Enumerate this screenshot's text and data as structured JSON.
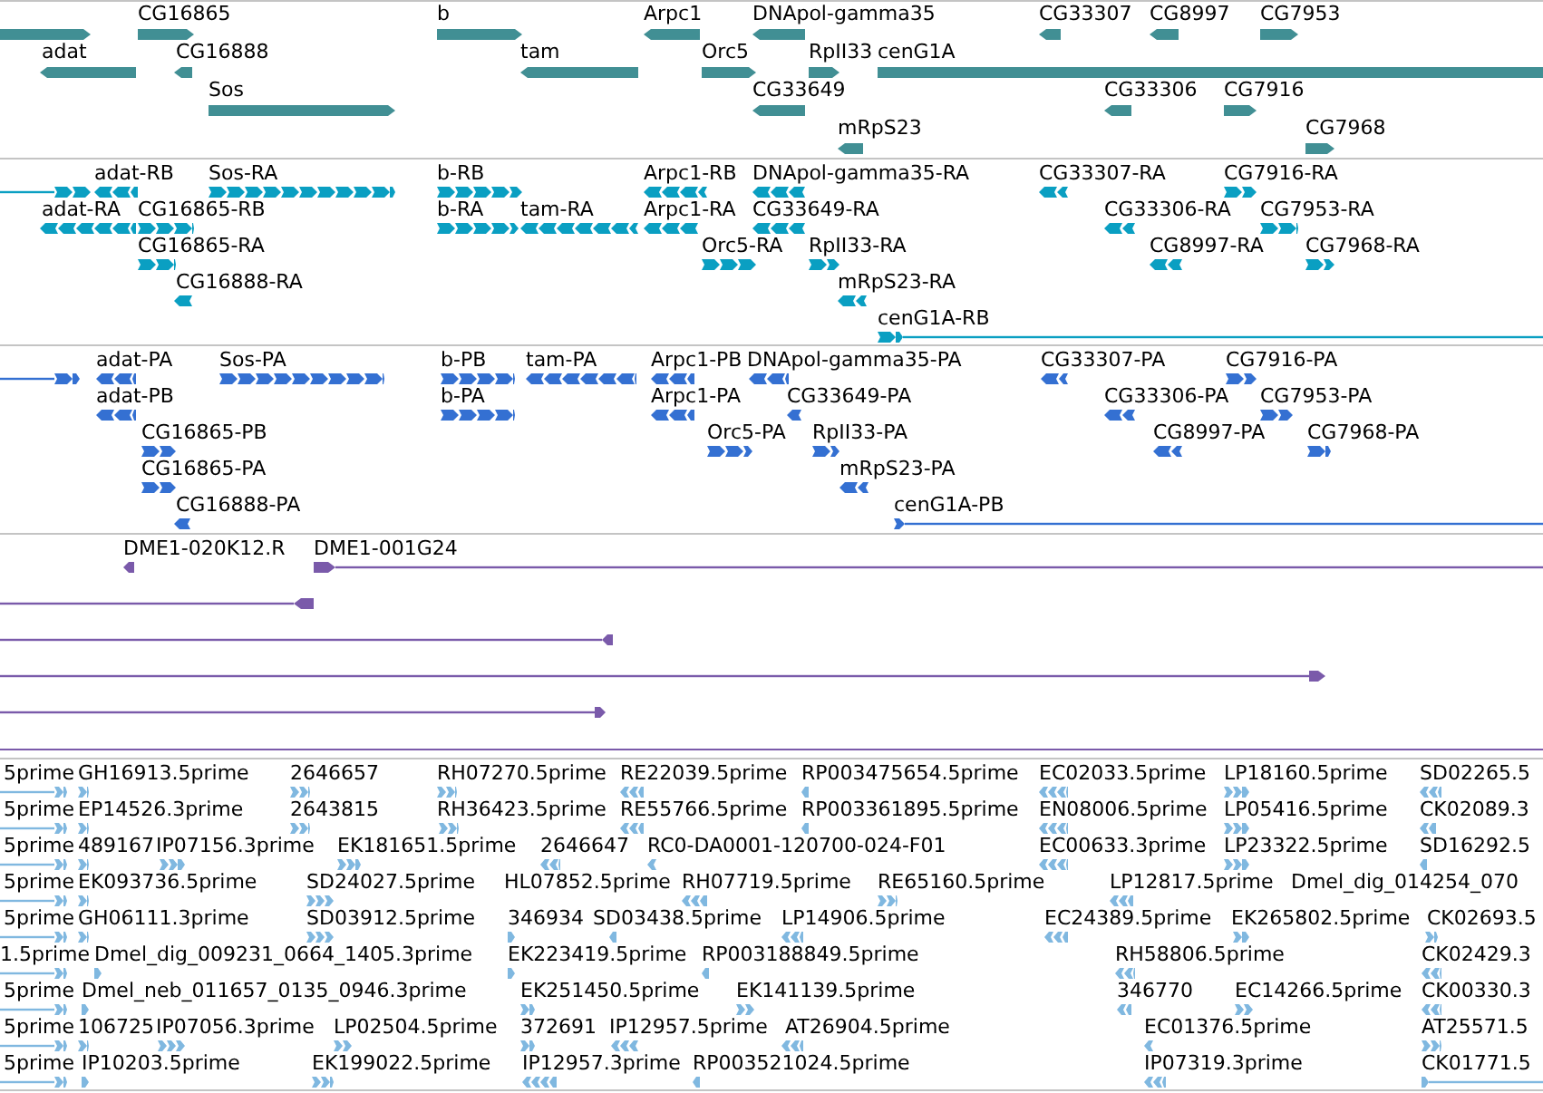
{
  "tracks": [
    {
      "kind": "gene",
      "color": "#418f94",
      "rows": [
        {
          "features": [
            {
              "reverse": false
            },
            {
              "label": "CG16865",
              "reverse": false
            },
            {
              "label": "b",
              "reverse": false
            },
            {
              "label": "Arpc1",
              "reverse": true
            },
            {
              "label": "DNApol-gamma35",
              "reverse": true
            },
            {
              "label": "CG33307",
              "reverse": true
            },
            {
              "label": "CG8997",
              "reverse": true
            },
            {
              "label": "CG7953",
              "reverse": false
            }
          ]
        },
        {
          "features": [
            {
              "label": "adat",
              "reverse": true
            },
            {
              "label": "CG16888",
              "reverse": true
            },
            {
              "label": "tam",
              "reverse": true
            },
            {
              "label": "Orc5",
              "reverse": false
            },
            {
              "label": "RpII33",
              "reverse": false
            },
            {
              "label": "cenG1A",
              "reverse": false
            }
          ]
        },
        {
          "features": [
            {
              "label": "Sos",
              "reverse": false
            },
            {
              "label": "CG33649",
              "reverse": true
            },
            {
              "label": "CG33306",
              "reverse": true
            },
            {
              "label": "CG7916",
              "reverse": false
            }
          ]
        },
        {
          "features": [
            {
              "label": "mRpS23",
              "reverse": true
            },
            {
              "label": "CG7968",
              "reverse": false
            }
          ]
        }
      ]
    },
    {
      "kind": "transcript",
      "color": "#0a9fc2",
      "rows": [
        {
          "features": [
            {
              "reverse": false
            },
            {
              "label": "adat-RB",
              "reverse": true
            },
            {
              "label": "Sos-RA",
              "reverse": false
            },
            {
              "label": "b-RB",
              "reverse": false
            },
            {
              "label": "Arpc1-RB",
              "reverse": true
            },
            {
              "label": "DNApol-gamma35-RA",
              "reverse": true
            },
            {
              "label": "CG33307-RA",
              "reverse": true
            },
            {
              "label": "CG7916-RA",
              "reverse": false
            }
          ]
        },
        {
          "features": [
            {
              "label": "adat-RA",
              "reverse": true
            },
            {
              "label": "CG16865-RB",
              "reverse": false
            },
            {
              "label": "b-RA",
              "reverse": false
            },
            {
              "label": "tam-RA",
              "reverse": true
            },
            {
              "label": "Arpc1-RA",
              "reverse": true
            },
            {
              "label": "CG33649-RA",
              "reverse": true
            },
            {
              "label": "CG33306-RA",
              "reverse": true
            },
            {
              "label": "CG7953-RA",
              "reverse": false
            }
          ]
        },
        {
          "features": [
            {
              "label": "CG16865-RA",
              "reverse": false
            },
            {
              "label": "Orc5-RA",
              "reverse": false
            },
            {
              "label": "RpII33-RA",
              "reverse": false
            },
            {
              "label": "CG8997-RA",
              "reverse": true
            },
            {
              "label": "CG7968-RA",
              "reverse": false
            }
          ]
        },
        {
          "features": [
            {
              "label": "CG16888-RA",
              "reverse": true
            },
            {
              "label": "mRpS23-RA",
              "reverse": true
            }
          ]
        },
        {
          "features": [
            {
              "label": "cenG1A-RB",
              "reverse": false
            }
          ]
        }
      ]
    },
    {
      "kind": "protein",
      "color": "#3470d2",
      "rows": [
        {
          "features": [
            {
              "reverse": false
            },
            {
              "label": "adat-PA",
              "reverse": true
            },
            {
              "label": "Sos-PA",
              "reverse": false
            },
            {
              "label": "b-PB",
              "reverse": false
            },
            {
              "label": "tam-PA",
              "reverse": true
            },
            {
              "label": "Arpc1-PB",
              "reverse": true
            },
            {
              "label": "DNApol-gamma35-PA",
              "reverse": true
            },
            {
              "label": "CG33307-PA",
              "reverse": true
            },
            {
              "label": "CG7916-PA",
              "reverse": false
            }
          ]
        },
        {
          "features": [
            {
              "label": "adat-PB",
              "reverse": true
            },
            {
              "label": "b-PA",
              "reverse": false
            },
            {
              "label": "Arpc1-PA",
              "reverse": true
            },
            {
              "label": "CG33649-PA",
              "reverse": true
            },
            {
              "label": "CG33306-PA",
              "reverse": true
            },
            {
              "label": "CG7953-PA",
              "reverse": false
            }
          ]
        },
        {
          "features": [
            {
              "label": "CG16865-PB",
              "reverse": false
            },
            {
              "label": "Orc5-PA",
              "reverse": false
            },
            {
              "label": "RpII33-PA",
              "reverse": false
            },
            {
              "label": "CG8997-PA",
              "reverse": true
            },
            {
              "label": "CG7968-PA",
              "reverse": false
            }
          ]
        },
        {
          "features": [
            {
              "label": "CG16865-PA",
              "reverse": false
            },
            {
              "label": "mRpS23-PA",
              "reverse": true
            }
          ]
        },
        {
          "features": [
            {
              "label": "CG16888-PA",
              "reverse": true
            },
            {
              "label": "cenG1A-PB",
              "reverse": false
            }
          ]
        }
      ]
    },
    {
      "kind": "clone",
      "color": "#7a5aaa",
      "rows": [
        {
          "features": [
            {
              "label": "DME1-020K12.R",
              "reverse": true
            },
            {
              "label": "DME1-001G24",
              "reverse": false
            }
          ]
        },
        {
          "features": [
            {
              "reverse": true
            }
          ]
        },
        {
          "features": [
            {
              "reverse": true
            }
          ]
        },
        {
          "features": [
            {
              "reverse": false
            }
          ]
        },
        {
          "features": [
            {
              "reverse": false
            }
          ]
        }
      ]
    },
    {
      "kind": "est",
      "color": "#80b8e0",
      "rows": [
        {
          "features": [
            {
              "label": "5prime",
              "reverse": false
            },
            {
              "label": "GH16913.5prime",
              "reverse": false
            },
            {
              "label": "2646657",
              "reverse": false
            },
            {
              "label": "RH07270.5prime",
              "reverse": false
            },
            {
              "label": "RE22039.5prime",
              "reverse": true
            },
            {
              "label": "RP003475654.5prime",
              "reverse": true
            },
            {
              "label": "EC02033.5prime",
              "reverse": true
            },
            {
              "label": "LP18160.5prime",
              "reverse": false
            },
            {
              "label": "SD02265.5",
              "reverse": true
            }
          ]
        },
        {
          "features": [
            {
              "label": "5prime",
              "reverse": false
            },
            {
              "label": "EP14526.3prime",
              "reverse": false
            },
            {
              "label": "2643815",
              "reverse": false
            },
            {
              "label": "RH36423.5prime",
              "reverse": false
            },
            {
              "label": "RE55766.5prime",
              "reverse": true
            },
            {
              "label": "RP003361895.5prime",
              "reverse": true
            },
            {
              "label": "EN08006.5prime",
              "reverse": true
            },
            {
              "label": "LP05416.5prime",
              "reverse": false
            },
            {
              "label": "CK02089.3",
              "reverse": true
            }
          ]
        },
        {
          "features": [
            {
              "label": "5prime",
              "reverse": false
            },
            {
              "label": "489167",
              "reverse": false
            },
            {
              "label": "IP07156.3prime",
              "reverse": false
            },
            {
              "label": "EK181651.5prime",
              "reverse": false
            },
            {
              "label": "2646647",
              "reverse": true
            },
            {
              "label": "RC0-DA0001-120700-024-F01",
              "reverse": true
            },
            {
              "label": "EC00633.3prime",
              "reverse": true
            },
            {
              "label": "LP23322.5prime",
              "reverse": false
            },
            {
              "label": "SD16292.5",
              "reverse": true
            }
          ]
        },
        {
          "features": [
            {
              "label": "5prime",
              "reverse": false
            },
            {
              "label": "EK093736.5prime",
              "reverse": false
            },
            {
              "label": "SD24027.5prime",
              "reverse": false
            },
            {
              "label": "HL07852.5prime"
            },
            {
              "label": "RH07719.5prime",
              "reverse": true
            },
            {
              "label": "RE65160.5prime",
              "reverse": false
            },
            {
              "label": "LP12817.5prime",
              "reverse": true
            },
            {
              "label": "Dmel_dig_014254_070"
            }
          ]
        },
        {
          "features": [
            {
              "label": "5prime",
              "reverse": false
            },
            {
              "label": "GH06111.3prime",
              "reverse": false
            },
            {
              "label": "SD03912.5prime",
              "reverse": false
            },
            {
              "label": "346934",
              "reverse": false
            },
            {
              "label": "SD03438.5prime",
              "reverse": true
            },
            {
              "label": "LP14906.5prime",
              "reverse": true
            },
            {
              "label": "EC24389.5prime",
              "reverse": true
            },
            {
              "label": "EK265802.5prime",
              "reverse": false
            },
            {
              "label": "CK02693.5",
              "reverse": false
            }
          ]
        },
        {
          "features": [
            {
              "label": "1.5prime",
              "reverse": false
            },
            {
              "label": "Dmel_dig_009231_0664_1405.3prime",
              "reverse": false
            },
            {
              "label": "EK223419.5prime",
              "reverse": false
            },
            {
              "label": "RP003188849.5prime",
              "reverse": true
            },
            {
              "label": "RH58806.5prime",
              "reverse": true
            },
            {
              "label": "CK02429.3",
              "reverse": true
            }
          ]
        },
        {
          "features": [
            {
              "label": "5prime",
              "reverse": false
            },
            {
              "label": "Dmel_neb_011657_0135_0946.3prime",
              "reverse": false
            },
            {
              "label": "EK251450.5prime",
              "reverse": false
            },
            {
              "label": "EK141139.5prime",
              "reverse": false
            },
            {
              "label": "346770",
              "reverse": true
            },
            {
              "label": "EC14266.5prime",
              "reverse": false
            },
            {
              "label": "CK00330.3",
              "reverse": true
            }
          ]
        },
        {
          "features": [
            {
              "label": "5prime",
              "reverse": false
            },
            {
              "label": "106725",
              "reverse": false
            },
            {
              "label": "IP07056.3prime",
              "reverse": false
            },
            {
              "label": "LP02504.5prime",
              "reverse": false
            },
            {
              "label": "372691",
              "reverse": false
            },
            {
              "label": "IP12957.5prime",
              "reverse": true
            },
            {
              "label": "AT26904.5prime",
              "reverse": true
            },
            {
              "label": "EC01376.5prime",
              "reverse": true
            },
            {
              "label": "AT25571.5",
              "reverse": false
            }
          ]
        },
        {
          "features": [
            {
              "label": "5prime",
              "reverse": false
            },
            {
              "label": "IP10203.5prime",
              "reverse": false
            },
            {
              "label": "EK199022.5prime",
              "reverse": false
            },
            {
              "label": "IP12957.3prime",
              "reverse": true
            },
            {
              "label": "RP003521024.5prime",
              "reverse": true
            },
            {
              "label": "IP07319.3prime",
              "reverse": true
            },
            {
              "label": "CK01771.5",
              "reverse": false
            }
          ]
        }
      ]
    }
  ]
}
